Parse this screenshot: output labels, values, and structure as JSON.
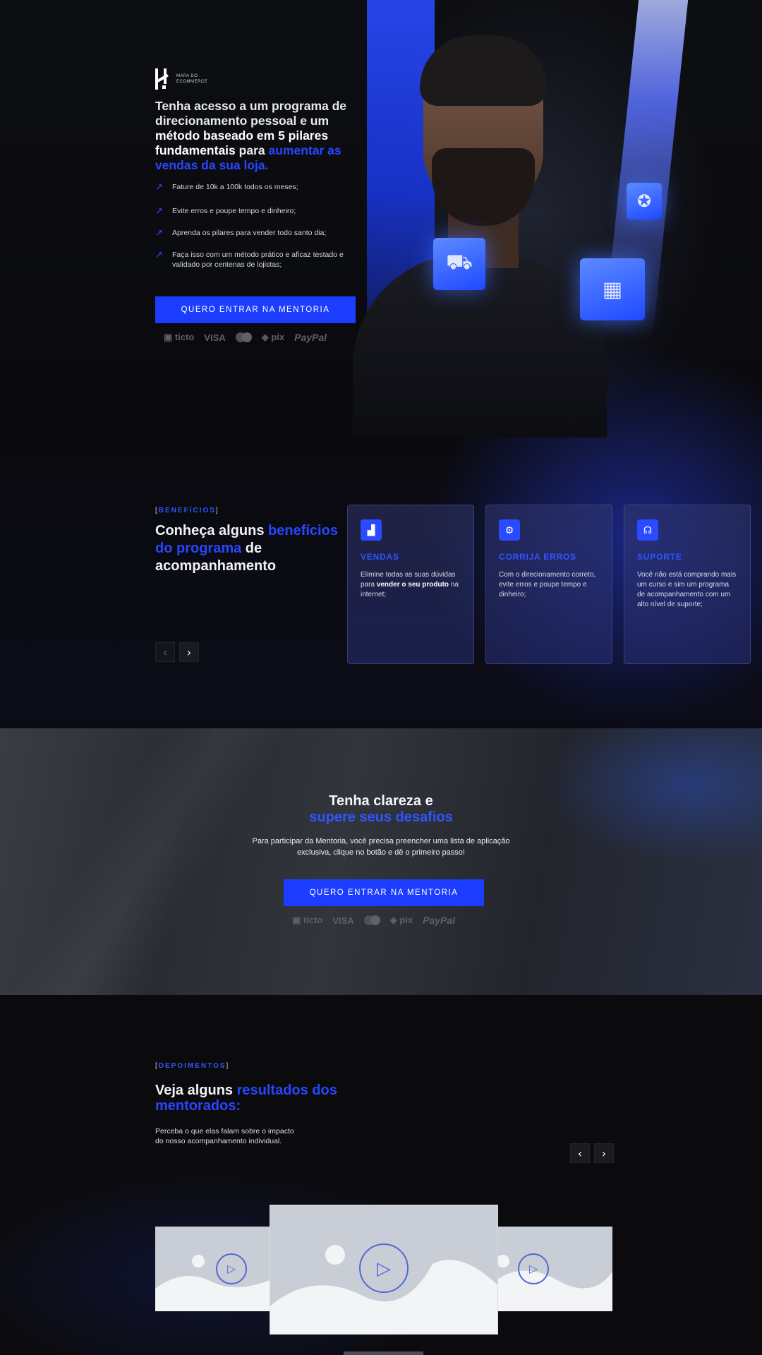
{
  "brand": {
    "logo_text": "MAPA DO ECOMMERCE"
  },
  "hero": {
    "title_pre": "Tenha acesso a um programa de direcionamento pessoal e um ",
    "title_bold": "método baseado em 5 pilares fundamentais",
    "title_mid": " para ",
    "title_highlight": "aumentar as vendas da sua loja.",
    "bullets": [
      "Fature de 10k a 100k todos os meses;",
      "Evite erros e poupe tempo e dinheiro;",
      "Aprenda os pilares para vender todo santo dia;",
      "Faça isso com um método prático e aficaz testado e validado por centenas de lojistas;"
    ],
    "cta_label": "QUERO ENTRAR NA MENTORIA",
    "payments": [
      "ticto",
      "VISA",
      "pix",
      "PayPal"
    ]
  },
  "benefits": {
    "tag": "BENEFÍCIOS",
    "title_pre": "Conheça alguns ",
    "title_highlight": "benefícios do programa",
    "title_post": " de acompanhamento",
    "cards": [
      {
        "icon": "chart-icon",
        "title": "VENDAS",
        "text_pre": "Elimine todas as suas dúvidas para ",
        "text_bold": "vender o seu produto",
        "text_post": " na internet;"
      },
      {
        "icon": "fix-icon",
        "title": "CORRIJA ERROS",
        "text": "Com o direcionamento correto, evite erros e poupe tempo e dinheiro;"
      },
      {
        "icon": "headset-icon",
        "title": "SUPORTE",
        "text": "Você não está comprando mais um curso e sim um programa de acompanhamento com um alto nível de suporte;"
      }
    ]
  },
  "clarity": {
    "title_line1": "Tenha clareza e",
    "title_highlight": "supere seus desafios",
    "text": "Para participar da Mentoria, você precisa preencher uma lista de aplicação exclusiva, clique no botão e dê o primeiro passo!",
    "cta_label": "QUERO ENTRAR NA MENTORIA"
  },
  "testimonials": {
    "tag": "DEPOIMENTOS",
    "title_pre": "Veja alguns ",
    "title_highlight": "resultados dos mentorados:",
    "text": "Perceba o que elas falam sobre o impacto do nosso acompanhamento individual."
  },
  "colors": {
    "accent": "#1c3dff",
    "highlight": "#2846ff",
    "background": "#0a0a0c"
  }
}
